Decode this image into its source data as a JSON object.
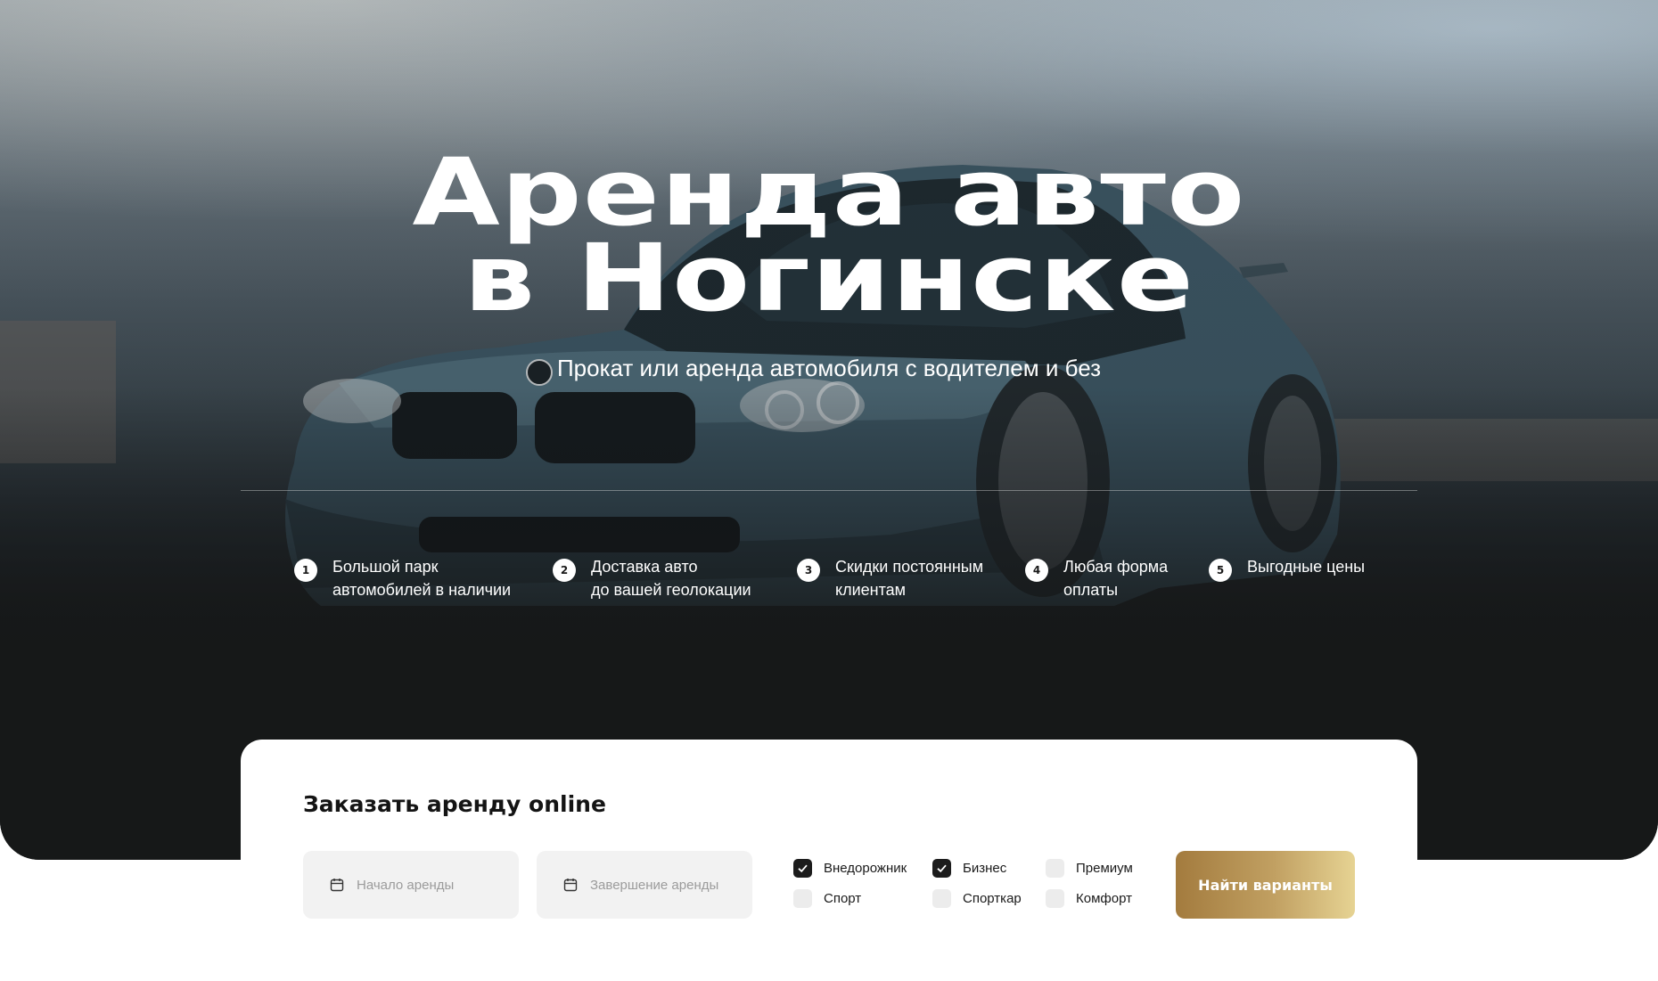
{
  "hero": {
    "title_line1": "Аренда авто",
    "title_line2": "в Ногинске",
    "subtitle": "Прокат или аренда автомобиля с водителем и без",
    "background_image": "blue-bmw-car-photo"
  },
  "features": [
    {
      "num": "1",
      "text": "Большой парк\nавтомобилей в наличии"
    },
    {
      "num": "2",
      "text": "Доставка авто\nдо вашей геолокации"
    },
    {
      "num": "3",
      "text": "Скидки постоянным\nклиентам"
    },
    {
      "num": "4",
      "text": "Любая форма\nоплаты"
    },
    {
      "num": "5",
      "text": "Выгодные цены"
    }
  ],
  "order": {
    "title": "Заказать аренду online",
    "start_placeholder": "Начало аренды",
    "end_placeholder": "Завершение аренды",
    "calendar_icon": "calendar-icon",
    "categories": [
      {
        "label": "Внедорожник",
        "checked": true
      },
      {
        "label": "Спорт",
        "checked": false
      },
      {
        "label": "Бизнес",
        "checked": true
      },
      {
        "label": "Спорткар",
        "checked": false
      },
      {
        "label": "Премиум",
        "checked": false
      },
      {
        "label": "Комфорт",
        "checked": false
      }
    ],
    "submit_label": "Найти варианты"
  },
  "colors": {
    "accent_gold_start": "#a37b3e",
    "accent_gold_end": "#e6d393",
    "dark": "#161818"
  }
}
